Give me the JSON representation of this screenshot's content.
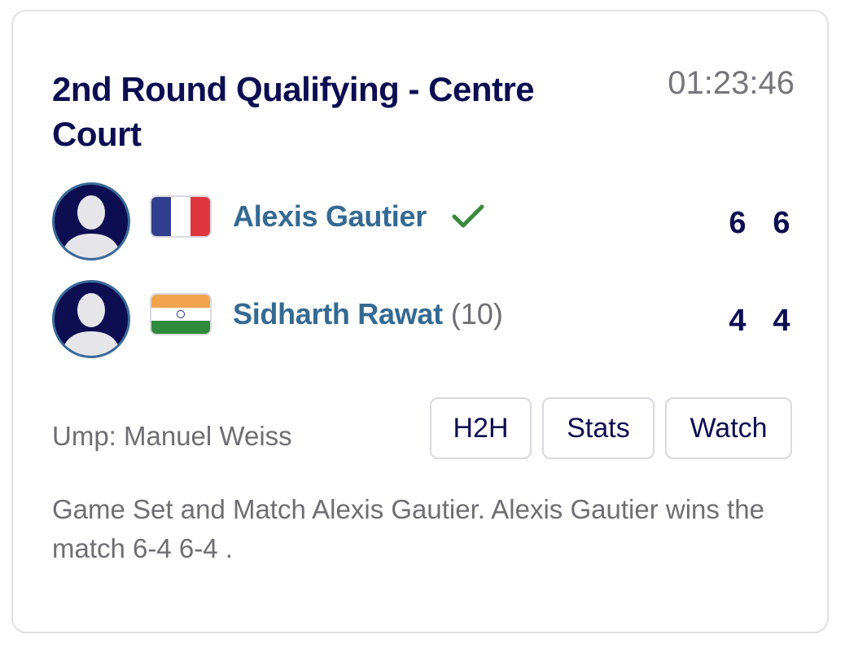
{
  "match": {
    "title": "2nd Round Qualifying - Centre Court",
    "clock": "01:23:46"
  },
  "players": [
    {
      "name": "Alexis Gautier",
      "seed": "",
      "flag": "france-flag",
      "winner": true,
      "sets": [
        "6",
        "6"
      ]
    },
    {
      "name": "Sidharth Rawat",
      "seed": "(10)",
      "flag": "india-flag",
      "winner": false,
      "sets": [
        "4",
        "4"
      ]
    }
  ],
  "umpire": "Ump: Manuel Weiss",
  "buttons": {
    "h2h": "H2H",
    "stats": "Stats",
    "watch": "Watch"
  },
  "summary": "Game Set and Match Alexis Gautier. Alexis Gautier wins the match 6-4 6-4 .",
  "colors": {
    "navy": "#0d0d52",
    "player_name": "#346a93",
    "muted": "#6e6e74",
    "winner_check": "#3a8a3e",
    "france_blue": "#2f3e8f",
    "france_red": "#e0363f",
    "india_saffron": "#f2a34e",
    "india_green": "#2e8a3c"
  }
}
